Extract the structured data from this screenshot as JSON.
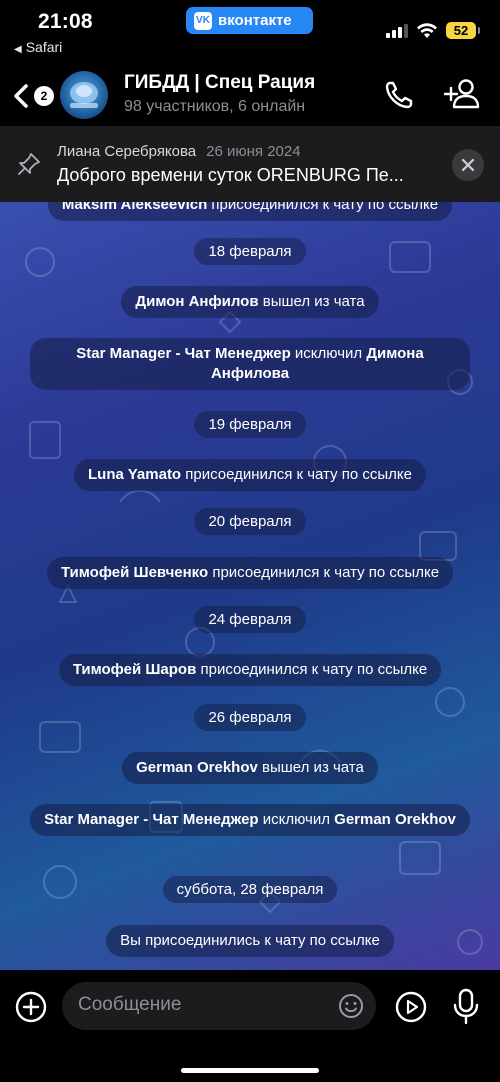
{
  "status_bar": {
    "time": "21:08",
    "back_app": "Safari",
    "vk_label": "вконтакте",
    "vk_logo": "VK",
    "battery": "52"
  },
  "header": {
    "unread_count": "2",
    "title": "ГИБДД | Спец Рация",
    "subtitle": "98 участников, 6 онлайн"
  },
  "pinned": {
    "author": "Лиана Серебрякова",
    "date": "26 июня 2024",
    "text": "Доброго времени суток ORENBURG Пе..."
  },
  "chat": {
    "partial_top": {
      "name": "Maksim Alekseevich",
      "action": " присоединился к чату по ссылке"
    },
    "items": [
      {
        "kind": "date",
        "text": "18 февраля"
      },
      {
        "kind": "msg",
        "name": "Димон Анфилов",
        "action": " вышел из чата"
      },
      {
        "kind": "msg2",
        "name": "Star Manager - Чат Менеджер",
        "action": " исключил ",
        "target": "Димона Анфилова"
      },
      {
        "kind": "date",
        "text": "19 февраля"
      },
      {
        "kind": "msg",
        "name": "Luna Yamato",
        "action": " присоединился к чату по ссылке"
      },
      {
        "kind": "date",
        "text": "20 февраля"
      },
      {
        "kind": "msg",
        "name": "Тимофей Шевченко",
        "action": " присоединился к чату по ссылке"
      },
      {
        "kind": "date",
        "text": "24 февраля"
      },
      {
        "kind": "msg",
        "name": "Тимофей Шаров",
        "action": " присоединился к чату по ссылке"
      },
      {
        "kind": "date",
        "text": "26 февраля"
      },
      {
        "kind": "msg",
        "name": "German Orekhov",
        "action": " вышел из чата"
      },
      {
        "kind": "msg2",
        "name": "Star Manager - Чат Менеджер",
        "action": " исключил ",
        "target": "German Orekhov"
      },
      {
        "kind": "date",
        "text": "суббота, 28 февраля"
      },
      {
        "kind": "plain",
        "text": "Вы присоединились к чату по ссылке"
      }
    ]
  },
  "composer": {
    "placeholder": "Сообщение"
  },
  "icons": {
    "back": "chevron-left-icon",
    "call": "phone-icon",
    "add_user": "add-user-icon",
    "pin": "pin-icon",
    "close": "close-icon",
    "plus": "plus-icon",
    "emoji": "emoji-icon",
    "video": "video-message-icon",
    "mic": "microphone-icon"
  }
}
